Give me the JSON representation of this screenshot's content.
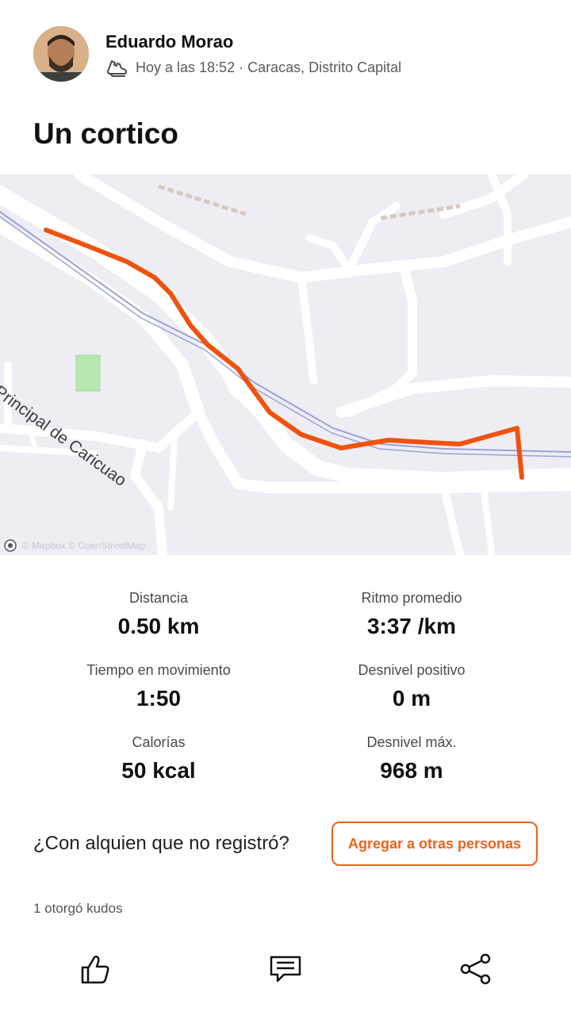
{
  "activity": {
    "athlete_name": "Eduardo Morao",
    "meta": "Hoy a las 18:52 · Caracas, Distrito Capital",
    "title": "Un cortico",
    "sport_icon": "running-shoe-icon"
  },
  "map": {
    "street_label": "Principal de Caricuao",
    "attribution": "© Mapbox © OpenStreetMap",
    "route_color": "#f0520c",
    "play_icon": "play-icon"
  },
  "stats": [
    {
      "label": "Distancia",
      "value": "0.50 km"
    },
    {
      "label": "Ritmo promedio",
      "value": "3:37 /km"
    },
    {
      "label": "Tiempo en movimiento",
      "value": "1:50"
    },
    {
      "label": "Desnivel positivo",
      "value": "0 m"
    },
    {
      "label": "Calorías",
      "value": "50 kcal"
    },
    {
      "label": "Desnivel máx.",
      "value": "968 m"
    }
  ],
  "tagging": {
    "question": "¿Con alquien que no registró?",
    "button_label": "Agregar a otras personas",
    "accent_color": "#f0621c"
  },
  "kudos": {
    "text": "1 otorgó kudos"
  },
  "actions": [
    {
      "name": "like",
      "icon": "thumbs-up-icon"
    },
    {
      "name": "comment",
      "icon": "comment-icon"
    },
    {
      "name": "share",
      "icon": "share-icon"
    }
  ]
}
